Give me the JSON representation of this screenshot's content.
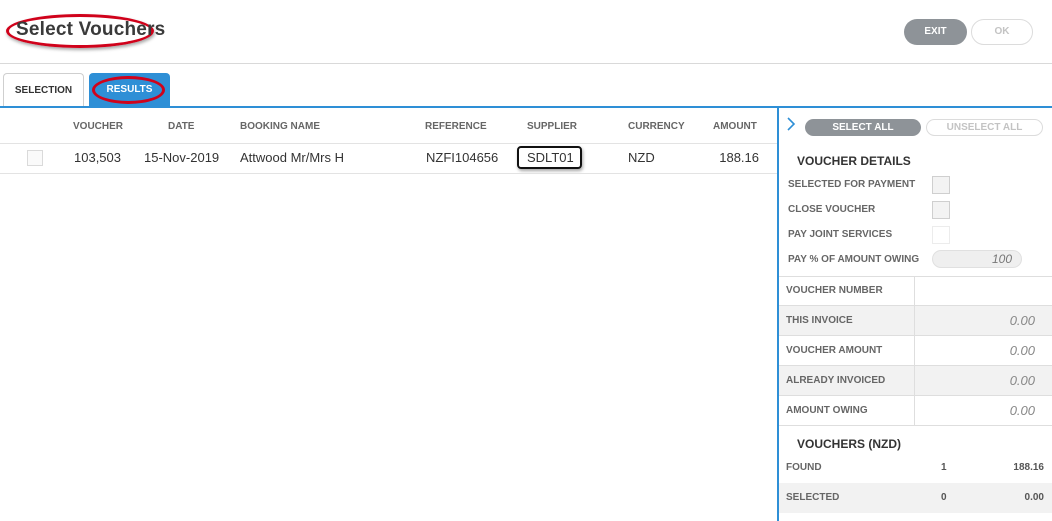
{
  "header": {
    "title": "Select Vouchers",
    "exit_label": "EXIT",
    "ok_label": "OK"
  },
  "tabs": [
    {
      "label": "SELECTION",
      "active": false
    },
    {
      "label": "RESULTS",
      "active": true
    }
  ],
  "table": {
    "columns": [
      "VOUCHER",
      "DATE",
      "BOOKING NAME",
      "REFERENCE",
      "SUPPLIER",
      "CURRENCY",
      "AMOUNT"
    ],
    "rows": [
      {
        "voucher": "103,503",
        "date": "15-Nov-2019",
        "booking_name": "Attwood Mr/Mrs H",
        "reference": "NZFI104656",
        "supplier": "SDLT01",
        "currency": "NZD",
        "amount": "188.16"
      }
    ]
  },
  "panel": {
    "select_all_label": "SELECT ALL",
    "unselect_all_label": "UNSELECT ALL",
    "details_title": "VOUCHER DETAILS",
    "options": {
      "selected_for_payment": "SELECTED FOR PAYMENT",
      "close_voucher": "CLOSE VOUCHER",
      "pay_joint_services": "PAY JOINT SERVICES",
      "pay_pct": "PAY % OF AMOUNT OWING",
      "pay_pct_value": "100"
    },
    "details": [
      {
        "label": "VOUCHER NUMBER",
        "value": ""
      },
      {
        "label": "THIS INVOICE",
        "value": "0.00"
      },
      {
        "label": "VOUCHER AMOUNT",
        "value": "0.00"
      },
      {
        "label": "ALREADY INVOICED",
        "value": "0.00"
      },
      {
        "label": "AMOUNT OWING",
        "value": "0.00"
      }
    ],
    "summary_title": "VOUCHERS (NZD)",
    "summary": [
      {
        "label": "FOUND",
        "count": "1",
        "amount": "188.16"
      },
      {
        "label": "SELECTED",
        "count": "0",
        "amount": "0.00"
      }
    ]
  },
  "colors": {
    "accent": "#2e8fd6",
    "highlight_ring": "#d0021b",
    "button_grey": "#8e9398"
  }
}
